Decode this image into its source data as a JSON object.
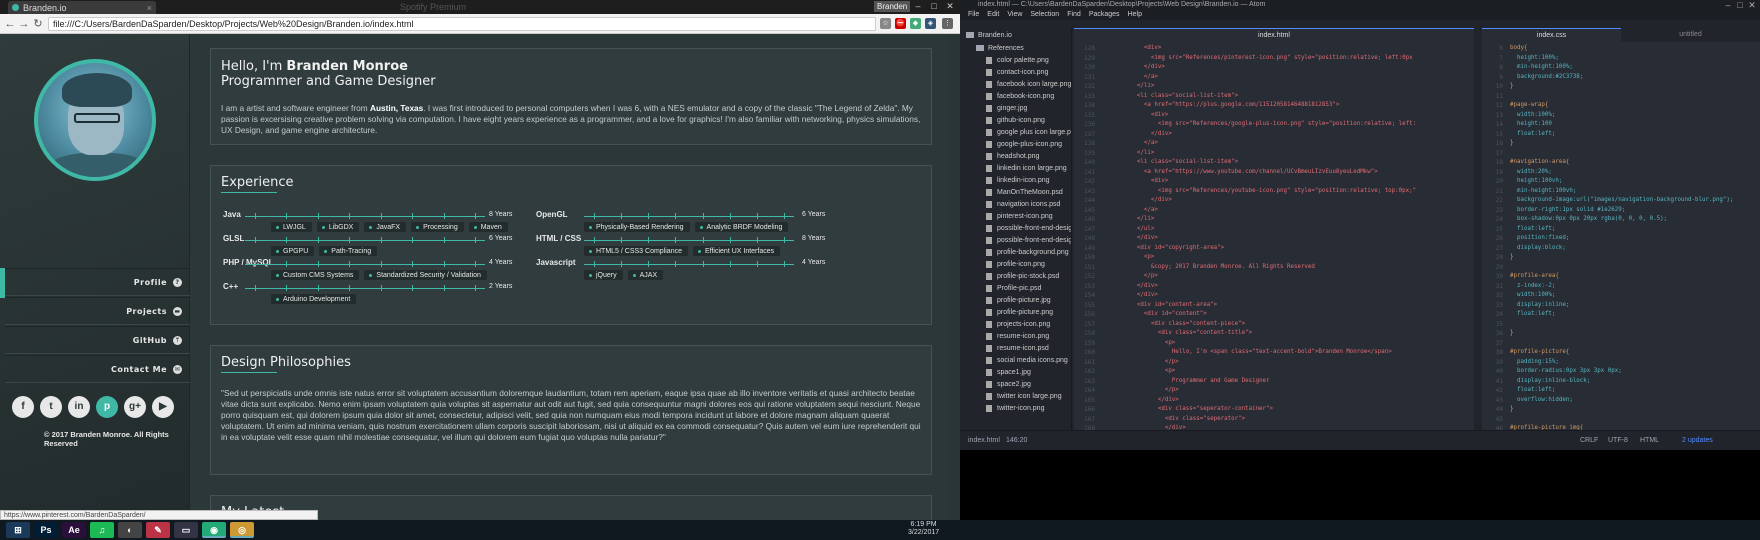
{
  "chrome": {
    "tab_title": "Branden.io",
    "tab_close": "×",
    "user_badge": "Branden",
    "url": "file:///C:/Users/BardenDaSparden/Desktop/Projects/Web%20Design/Branden.io/index.html",
    "ghost_title": "Spotify Premium",
    "status_url": "https://www.pinterest.com/BardenDaSparden/"
  },
  "site": {
    "hero": {
      "greeting_prefix": "Hello, I'm ",
      "name": "Branden Monroe",
      "subtitle": "Programmer and Game Designer",
      "bio_a": "I am a artist and software engineer from ",
      "bio_city": "Austin, Texas",
      "bio_b": ". I was first introduced to personal computers when I was 6, with a NES emulator and a copy of the classic \"The Legend of Zelda\". My passion is excersising creative problem solving via computation. I have eight years experience as a programmer, and a love for graphics! I'm also familiar with networking, physics simulations, UX Design, and game engine architecture."
    },
    "experience": {
      "title": "Experience",
      "left": [
        {
          "name": "Java",
          "years": "8 Years",
          "fill": 1.0,
          "tags": [
            "LWJGL",
            "LibGDX",
            "JavaFX",
            "Processing",
            "Maven"
          ]
        },
        {
          "name": "GLSL",
          "years": "6 Years",
          "fill": 1.0,
          "tags": [
            "GPGPU",
            "Path-Tracing"
          ]
        },
        {
          "name": "PHP / MySQL",
          "years": "4 Years",
          "fill": 1.0,
          "tags": [
            "Custom CMS Systems",
            "Standardized Security / Validation"
          ]
        },
        {
          "name": "C++",
          "years": "2 Years",
          "fill": 1.0,
          "tags": [
            "Arduino Development"
          ]
        }
      ],
      "right": [
        {
          "name": "OpenGL",
          "years": "6 Years",
          "fill": 1.0,
          "tags": [
            "Physically-Based Rendering",
            "Analytic BRDF Modeling"
          ]
        },
        {
          "name": "HTML / CSS",
          "years": "8 Years",
          "fill": 1.0,
          "tags": [
            "HTML5 / CSS3 Compliance",
            "Efficient UX Interfaces"
          ]
        },
        {
          "name": "Javascript",
          "years": "4 Years",
          "fill": 1.0,
          "tags": [
            "jQuery",
            "AJAX"
          ]
        }
      ]
    },
    "philosophies": {
      "title": "Design Philosophies",
      "quote": "\"Sed ut perspiciatis unde omnis iste natus error sit voluptatem accusantium doloremque laudantium, totam rem aperiam, eaque ipsa quae ab illo inventore veritatis et quasi architecto beatae vitae dicta sunt explicabo. Nemo enim ipsam voluptatem quia voluptas sit aspernatur aut odit aut fugit, sed quia consequuntur magni dolores eos qui ratione voluptatem sequi nesciunt. Neque porro quisquam est, qui dolorem ipsum quia dolor sit amet, consectetur, adipisci velit, sed quia non numquam eius modi tempora incidunt ut labore et dolore magnam aliquam quaerat voluptatem. Ut enim ad minima veniam, quis nostrum exercitationem ullam corporis suscipit laboriosam, nisi ut aliquid ex ea commodi consequatur? Quis autem vel eum iure reprehenderit qui in ea voluptate velit esse quam nihil molestiae consequatur, vel illum qui dolorem eum fugiat quo voluptas nulla pariatur?\""
    },
    "latest": {
      "title": "My Latest"
    },
    "nav": [
      {
        "label": "Profile",
        "icon": "?",
        "active": true
      },
      {
        "label": "Projects",
        "icon": "▬"
      },
      {
        "label": "GitHub",
        "icon": "ᛘ"
      },
      {
        "label": "Contact Me",
        "icon": "✉"
      }
    ],
    "social": [
      "f",
      "t",
      "in",
      "p",
      "g+",
      "▶"
    ],
    "copyright": "© 2017 Branden Monroe. All Rights Reserved"
  },
  "atom": {
    "title": "index.html — C:\\Users\\BardenDaSparden\\Desktop\\Projects\\Web Design\\Branden.io — Atom",
    "menu": [
      "File",
      "Edit",
      "View",
      "Selection",
      "Find",
      "Packages",
      "Help"
    ],
    "tree_root": "Branden.io",
    "tree_folder": "References",
    "files": [
      "color palette.png",
      "contact-icon.png",
      "facebook icon large.png",
      "facebook-icon.png",
      "ginger.jpg",
      "github-icon.png",
      "google plus icon large.png",
      "google-plus-icon.png",
      "headshot.png",
      "linkedin icon large.png",
      "linkedin-icon.png",
      "ManOnTheMoon.psd",
      "navigation icons.psd",
      "pinterest-icon.png",
      "possible-front-end-design.png",
      "possible-front-end-design2.png",
      "profile-background.png",
      "profile-icon.png",
      "profile-pic-stock.psd",
      "Profile-pic.psd",
      "profile-picture.jpg",
      "profile-picture.png",
      "projects-icon.png",
      "resume-icon.png",
      "resume-icon.psd",
      "social media icons.png",
      "space1.jpg",
      "space2.jpg",
      "twitter icon large.png",
      "twitter-icon.png"
    ],
    "tabs_left": [
      "index.html"
    ],
    "tabs_right": [
      "index.css",
      "untitled"
    ],
    "left_start_line": 128,
    "right_start_line": 6,
    "status": {
      "file": "index.html",
      "pos": "146:20",
      "eol": "CRLF",
      "enc": "UTF-8",
      "grammar": "HTML",
      "updates": "2 updates"
    }
  },
  "taskbar": {
    "time": "6:19 PM",
    "date": "3/22/2017",
    "apps": [
      "⊞",
      "Ps",
      "Ae",
      "♫",
      "◐",
      "✎",
      "▭",
      "◉",
      "◎"
    ]
  }
}
